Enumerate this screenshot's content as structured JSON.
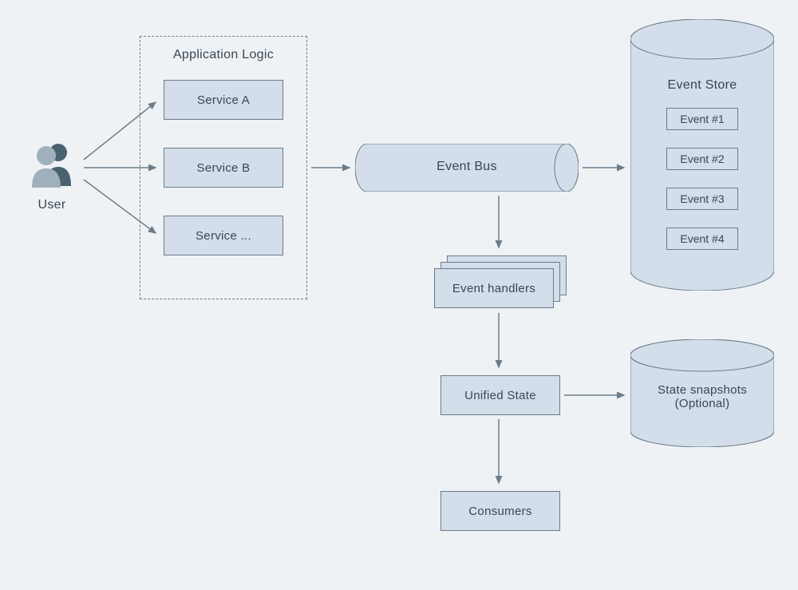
{
  "user": {
    "label": "User"
  },
  "appLogic": {
    "title": "Application Logic",
    "services": [
      "Service A",
      "Service B",
      "Service ..."
    ]
  },
  "eventBus": {
    "label": "Event Bus"
  },
  "eventStore": {
    "title": "Event Store",
    "events": [
      "Event #1",
      "Event #2",
      "Event #3",
      "Event #4"
    ]
  },
  "eventHandlers": {
    "label": "Event handlers"
  },
  "unifiedState": {
    "label": "Unified State"
  },
  "snapshots": {
    "line1": "State snapshots",
    "line2": "(Optional)"
  },
  "consumers": {
    "label": "Consumers"
  }
}
